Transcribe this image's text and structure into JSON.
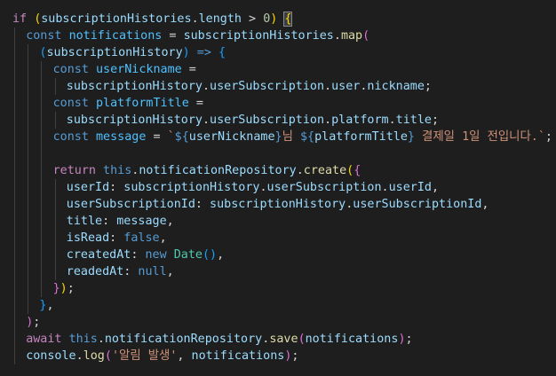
{
  "editor": {
    "language": "typescript",
    "theme_background": "#1e1e1e",
    "lines": [
      {
        "indent": 0,
        "tokens": [
          [
            "if",
            "control"
          ],
          [
            " ",
            "punct"
          ],
          [
            "(",
            "bracket-gold"
          ],
          [
            "subscriptionHistories",
            "var"
          ],
          [
            ".",
            "punct"
          ],
          [
            "length",
            "prop"
          ],
          [
            " > ",
            "punct"
          ],
          [
            "0",
            "number"
          ],
          [
            ")",
            "bracket-gold"
          ],
          [
            " ",
            "punct"
          ],
          [
            "{",
            "bracket-gold-match"
          ]
        ]
      },
      {
        "indent": 1,
        "tokens": [
          [
            "const",
            "keyword"
          ],
          [
            " ",
            "punct"
          ],
          [
            "notifications",
            "const"
          ],
          [
            " = ",
            "punct"
          ],
          [
            "subscriptionHistories",
            "var"
          ],
          [
            ".",
            "punct"
          ],
          [
            "map",
            "func"
          ],
          [
            "(",
            "bracket-pink"
          ]
        ]
      },
      {
        "indent": 2,
        "tokens": [
          [
            "(",
            "bracket-blue"
          ],
          [
            "subscriptionHistory",
            "var"
          ],
          [
            ")",
            "bracket-blue"
          ],
          [
            " => ",
            "keyword"
          ],
          [
            "{",
            "bracket-blue"
          ]
        ]
      },
      {
        "indent": 3,
        "tokens": [
          [
            "const",
            "keyword"
          ],
          [
            " ",
            "punct"
          ],
          [
            "userNickname",
            "const"
          ],
          [
            " =",
            "punct"
          ]
        ]
      },
      {
        "indent": 4,
        "tokens": [
          [
            "subscriptionHistory",
            "var"
          ],
          [
            ".",
            "punct"
          ],
          [
            "userSubscription",
            "prop"
          ],
          [
            ".",
            "punct"
          ],
          [
            "user",
            "prop"
          ],
          [
            ".",
            "punct"
          ],
          [
            "nickname",
            "prop"
          ],
          [
            ";",
            "punct"
          ]
        ]
      },
      {
        "indent": 3,
        "tokens": [
          [
            "const",
            "keyword"
          ],
          [
            " ",
            "punct"
          ],
          [
            "platformTitle",
            "const"
          ],
          [
            " =",
            "punct"
          ]
        ]
      },
      {
        "indent": 4,
        "tokens": [
          [
            "subscriptionHistory",
            "var"
          ],
          [
            ".",
            "punct"
          ],
          [
            "userSubscription",
            "prop"
          ],
          [
            ".",
            "punct"
          ],
          [
            "platform",
            "prop"
          ],
          [
            ".",
            "punct"
          ],
          [
            "title",
            "prop"
          ],
          [
            ";",
            "punct"
          ]
        ]
      },
      {
        "indent": 3,
        "tokens": [
          [
            "const",
            "keyword"
          ],
          [
            " ",
            "punct"
          ],
          [
            "message",
            "const"
          ],
          [
            " = ",
            "punct"
          ],
          [
            "`",
            "string"
          ],
          [
            "${",
            "keyword"
          ],
          [
            "userNickname",
            "var"
          ],
          [
            "}",
            "keyword"
          ],
          [
            "님 ",
            "string"
          ],
          [
            "${",
            "keyword"
          ],
          [
            "platformTitle",
            "var"
          ],
          [
            "}",
            "keyword"
          ],
          [
            " 결제일 1일 전입니다.`",
            "string"
          ],
          [
            ";",
            "punct"
          ]
        ]
      },
      {
        "indent": 3,
        "tokens": []
      },
      {
        "indent": 3,
        "tokens": [
          [
            "return",
            "control"
          ],
          [
            " ",
            "punct"
          ],
          [
            "this",
            "this"
          ],
          [
            ".",
            "punct"
          ],
          [
            "notificationRepository",
            "prop"
          ],
          [
            ".",
            "punct"
          ],
          [
            "create",
            "func"
          ],
          [
            "(",
            "bracket-gold"
          ],
          [
            "{",
            "bracket-pink"
          ]
        ]
      },
      {
        "indent": 4,
        "tokens": [
          [
            "userId",
            "prop"
          ],
          [
            ": ",
            "punct"
          ],
          [
            "subscriptionHistory",
            "var"
          ],
          [
            ".",
            "punct"
          ],
          [
            "userSubscription",
            "prop"
          ],
          [
            ".",
            "punct"
          ],
          [
            "userId",
            "prop"
          ],
          [
            ",",
            "punct"
          ]
        ]
      },
      {
        "indent": 4,
        "tokens": [
          [
            "userSubscriptionId",
            "prop"
          ],
          [
            ": ",
            "punct"
          ],
          [
            "subscriptionHistory",
            "var"
          ],
          [
            ".",
            "punct"
          ],
          [
            "userSubscriptionId",
            "prop"
          ],
          [
            ",",
            "punct"
          ]
        ]
      },
      {
        "indent": 4,
        "tokens": [
          [
            "title",
            "prop"
          ],
          [
            ": ",
            "punct"
          ],
          [
            "message",
            "var"
          ],
          [
            ",",
            "punct"
          ]
        ]
      },
      {
        "indent": 4,
        "tokens": [
          [
            "isRead",
            "prop"
          ],
          [
            ": ",
            "punct"
          ],
          [
            "false",
            "keyword"
          ],
          [
            ",",
            "punct"
          ]
        ]
      },
      {
        "indent": 4,
        "tokens": [
          [
            "createdAt",
            "prop"
          ],
          [
            ": ",
            "punct"
          ],
          [
            "new",
            "keyword"
          ],
          [
            " ",
            "punct"
          ],
          [
            "Date",
            "class"
          ],
          [
            "()",
            "bracket-blue"
          ],
          [
            ",",
            "punct"
          ]
        ]
      },
      {
        "indent": 4,
        "tokens": [
          [
            "readedAt",
            "prop"
          ],
          [
            ": ",
            "punct"
          ],
          [
            "null",
            "keyword"
          ],
          [
            ",",
            "punct"
          ]
        ]
      },
      {
        "indent": 3,
        "tokens": [
          [
            "}",
            "bracket-pink"
          ],
          [
            ")",
            "bracket-gold"
          ],
          [
            ";",
            "punct"
          ]
        ]
      },
      {
        "indent": 2,
        "tokens": [
          [
            "}",
            "bracket-blue"
          ],
          [
            ",",
            "punct"
          ]
        ]
      },
      {
        "indent": 1,
        "tokens": [
          [
            ")",
            "bracket-pink"
          ],
          [
            ";",
            "punct"
          ]
        ]
      },
      {
        "indent": 1,
        "tokens": [
          [
            "await",
            "control"
          ],
          [
            " ",
            "punct"
          ],
          [
            "this",
            "this"
          ],
          [
            ".",
            "punct"
          ],
          [
            "notificationRepository",
            "prop"
          ],
          [
            ".",
            "punct"
          ],
          [
            "save",
            "func"
          ],
          [
            "(",
            "bracket-pink"
          ],
          [
            "notifications",
            "var"
          ],
          [
            ")",
            "bracket-pink"
          ],
          [
            ";",
            "punct"
          ]
        ]
      },
      {
        "indent": 1,
        "tokens": [
          [
            "console",
            "var"
          ],
          [
            ".",
            "punct"
          ],
          [
            "log",
            "func"
          ],
          [
            "(",
            "bracket-pink"
          ],
          [
            "'알림 발생'",
            "string"
          ],
          [
            ", ",
            "punct"
          ],
          [
            "notifications",
            "var"
          ],
          [
            ")",
            "bracket-pink"
          ],
          [
            ";",
            "punct"
          ]
        ]
      }
    ]
  },
  "colors": {
    "keyword": "#569cd6",
    "control": "#c586c0",
    "variable": "#9cdcfe",
    "constant": "#4fc1ff",
    "function": "#dcdcaa",
    "number": "#b5cea8",
    "string": "#ce9178",
    "class": "#4ec9b0",
    "bracket_gold": "#ffd700",
    "bracket_pink": "#da70d6",
    "bracket_blue": "#179fff"
  }
}
